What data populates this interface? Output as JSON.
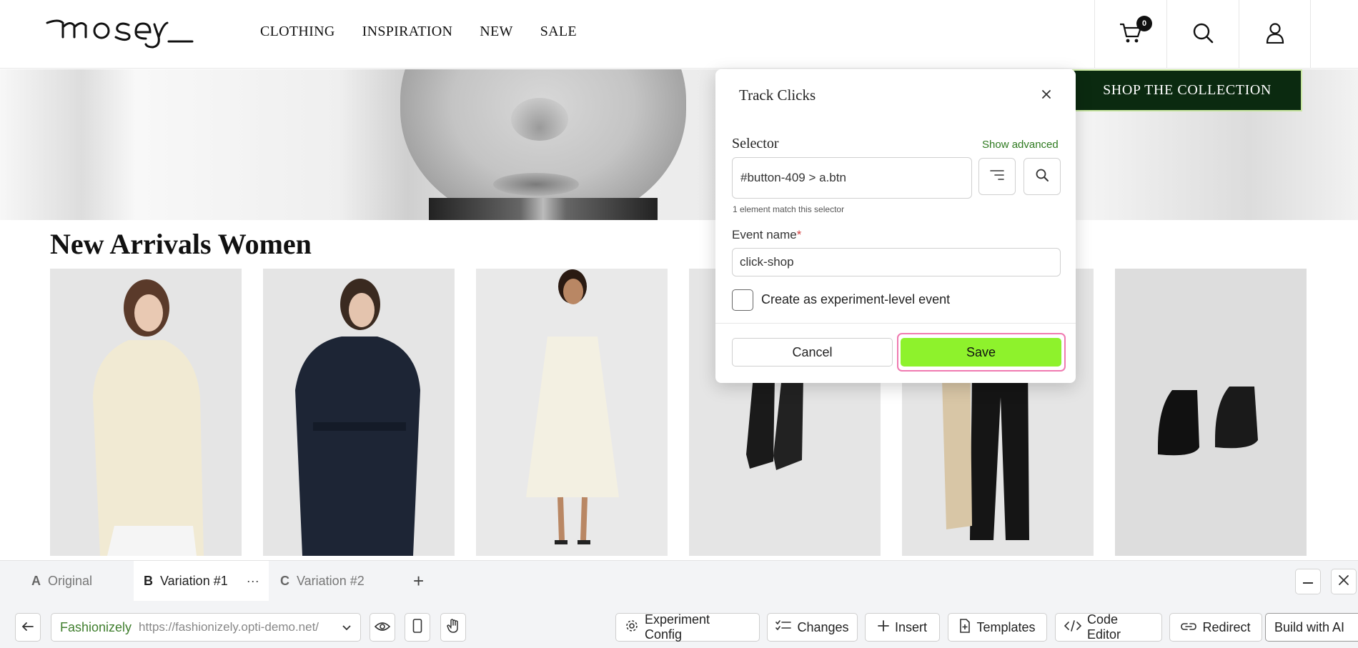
{
  "site": {
    "logo_text": "mosey",
    "nav": [
      "CLOTHING",
      "INSPIRATION",
      "NEW",
      "SALE"
    ],
    "cart_count": "0",
    "icons": [
      "cart-icon",
      "search-icon",
      "user-icon"
    ]
  },
  "hero": {
    "shop_button": "SHOP THE COLLECTION"
  },
  "section": {
    "title": "New Arrivals Women",
    "products": [
      "cream-shirt",
      "navy-coat",
      "white-halter-dress",
      "black-knee-boots",
      "black-trousers-tote",
      "black-ankle-boots"
    ]
  },
  "modal": {
    "title": "Track Clicks",
    "selector_label": "Selector",
    "show_advanced": "Show advanced",
    "selector_value": "#button-409 > a.btn",
    "match_text": "1 element match this selector",
    "event_label": "Event name",
    "required_mark": "*",
    "event_value": "click-shop",
    "checkbox_label": "Create as experiment-level event",
    "checkbox_checked": false,
    "cancel": "Cancel",
    "save": "Save"
  },
  "editor": {
    "tabs": [
      {
        "letter": "A",
        "label": "Original"
      },
      {
        "letter": "B",
        "label": "Variation #1"
      },
      {
        "letter": "C",
        "label": "Variation #2"
      }
    ],
    "more_label": "···",
    "add_label": "+",
    "url_name": "Fashionizely",
    "url": "https://fashionizely.opti-demo.net/",
    "toolbar": {
      "experiment_config": "Experiment Config",
      "changes": "Changes",
      "insert": "Insert",
      "templates": "Templates",
      "code_editor": "Code Editor",
      "redirect": "Redirect",
      "build_ai": "Build with AI"
    }
  },
  "colors": {
    "shop_button_bg": "#0b2a10",
    "save_bg": "#8ef22c",
    "save_ring": "#f07ab0",
    "link_green": "#2e7a1f"
  }
}
